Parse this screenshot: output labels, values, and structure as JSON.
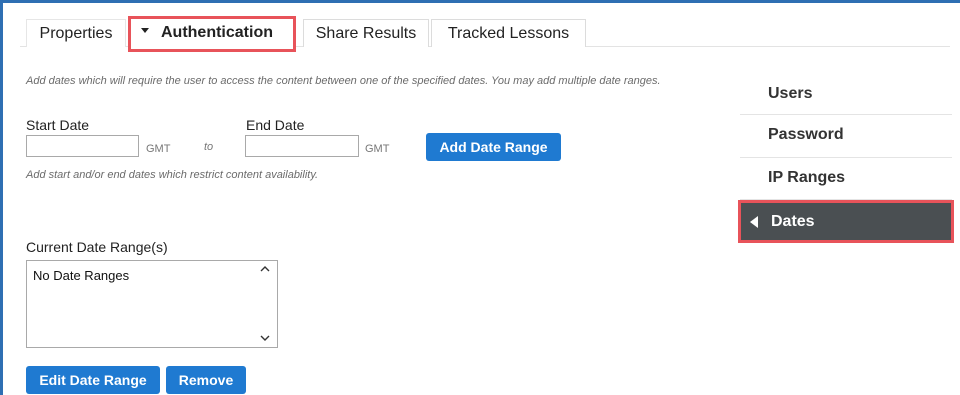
{
  "tabs": [
    {
      "label": "Properties"
    },
    {
      "label": "Authentication"
    },
    {
      "label": "Share Results"
    },
    {
      "label": "Tracked Lessons"
    }
  ],
  "active_tab": "Authentication",
  "help_text": "Add dates which will require the user to access the content between one of the specified dates. You may add multiple date ranges.",
  "form": {
    "start_label": "Start Date",
    "end_label": "End Date",
    "start_value": "",
    "end_value": "",
    "timezone": "GMT",
    "separator": "to",
    "add_button": "Add Date Range",
    "restrict_help": "Add start and/or end dates which restrict content availability."
  },
  "current": {
    "label": "Current Date Range(s)",
    "items": [
      "No Date Ranges"
    ]
  },
  "actions": {
    "edit": "Edit Date Range",
    "remove": "Remove"
  },
  "side_nav": [
    {
      "label": "Users"
    },
    {
      "label": "Password"
    },
    {
      "label": "IP Ranges"
    },
    {
      "label": "Dates"
    }
  ],
  "active_side": "Dates",
  "colors": {
    "accent": "#1f7ad1",
    "highlight": "#e8535a",
    "active_side_bg": "#4a4f52"
  }
}
